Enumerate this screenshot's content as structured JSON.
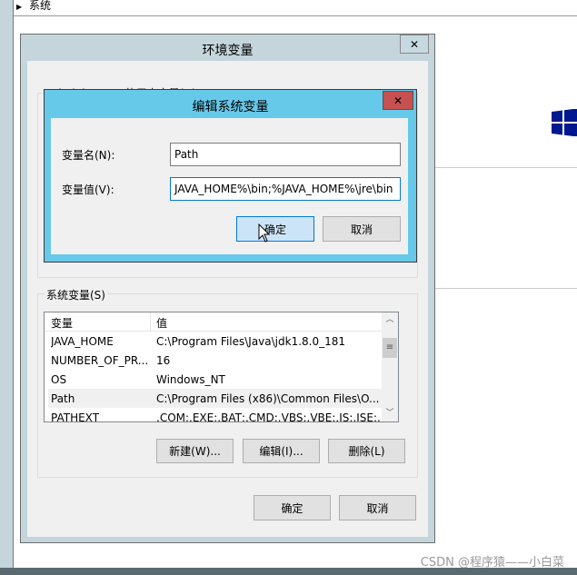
{
  "background": {
    "tree_item": "系统"
  },
  "env_dialog": {
    "title": "环境变量",
    "close_label": "✕",
    "user_group_label": "Administrator 的用户变量(U)",
    "system_group_label": "系统变量(S)",
    "columns": [
      "变量",
      "值"
    ],
    "rows": [
      {
        "name": "JAVA_HOME",
        "value": "C:\\Program Files\\Java\\jdk1.8.0_181"
      },
      {
        "name": "NUMBER_OF_PR...",
        "value": "16"
      },
      {
        "name": "OS",
        "value": "Windows_NT"
      },
      {
        "name": "Path",
        "value": "C:\\Program Files (x86)\\Common Files\\O..."
      },
      {
        "name": "PATHEXT",
        "value": ".COM;.EXE;.BAT;.CMD;.VBS;.VBE;.JS;.JSE;..."
      }
    ],
    "new_button": "新建(W)...",
    "edit_button": "编辑(I)...",
    "delete_button": "删除(L)",
    "ok_button": "确定",
    "cancel_button": "取消"
  },
  "edit_dialog": {
    "title": "编辑系统变量",
    "close_label": "✕",
    "name_label": "变量名(N):",
    "name_value": "Path",
    "value_label": "变量值(V):",
    "value_value": "JAVA_HOME%\\bin;%JAVA_HOME%\\jre\\bin",
    "ok_button": "确定",
    "cancel_button": "取消"
  },
  "colors": {
    "edit_titlebar": "#66c9ea",
    "env_titlebar": "#c4d5dc",
    "close_red": "#c75050",
    "windows_logo": "#00188f"
  },
  "watermark": "CSDN @程序猿——小白菜"
}
